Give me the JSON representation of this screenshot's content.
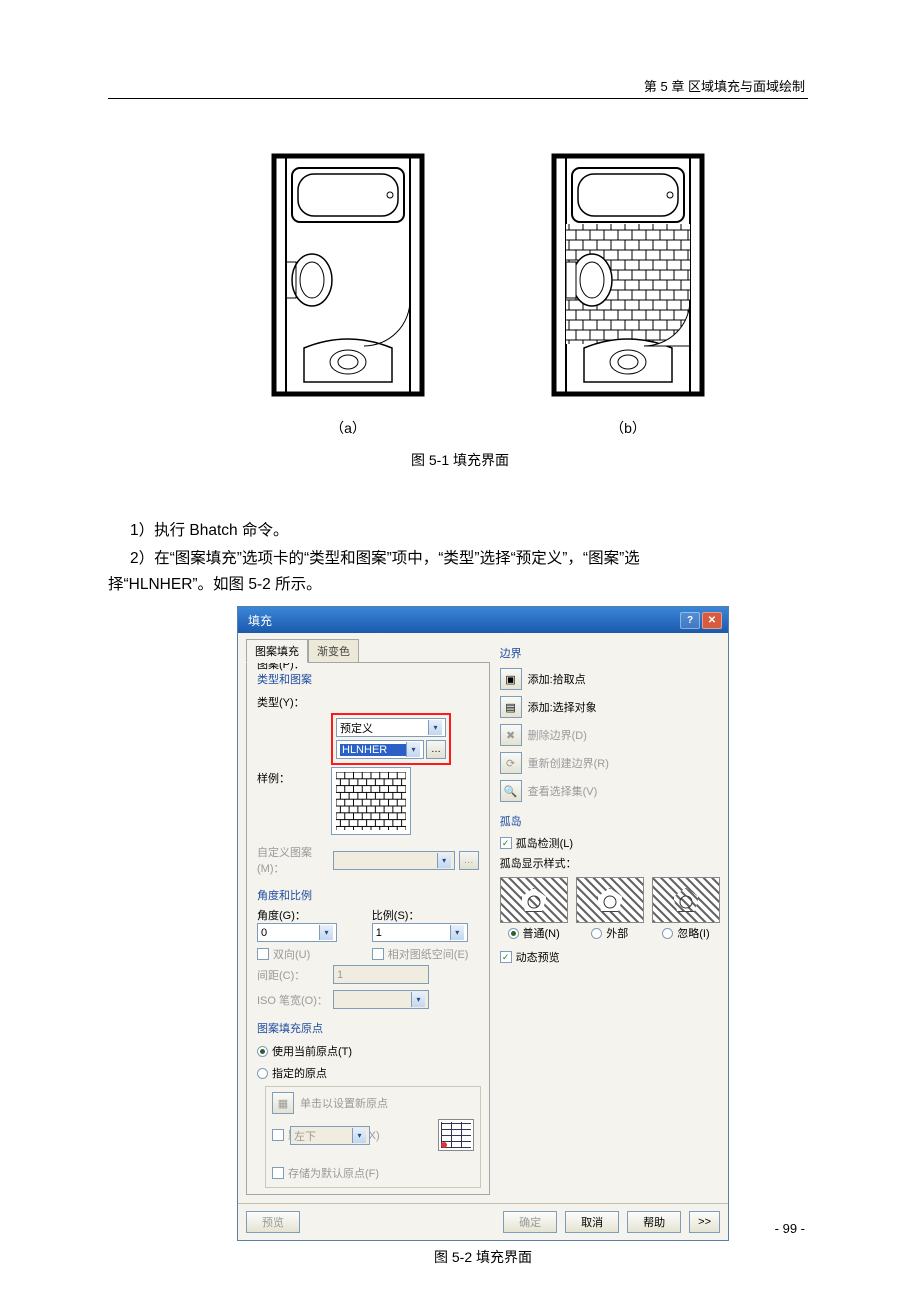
{
  "header": {
    "chapter": "第 5 章  区域填充与面域绘制"
  },
  "fig51": {
    "label_a": "（a）",
    "label_b": "（b）",
    "caption": "图 5-1 填充界面"
  },
  "body": {
    "line1": "1）执行 Bhatch 命令。",
    "line2": "2）在“图案填充”选项卡的“类型和图案”项中，“类型”选择“预定义”，“图案”选",
    "line3": "择“HLNHER”。如图 5-2 所示。"
  },
  "dialog": {
    "title": "填充",
    "tabs": {
      "hatch": "图案填充",
      "gradient": "渐变色"
    },
    "type_group": {
      "legend": "类型和图案",
      "type_label": "类型(Y)：",
      "type_value": "预定义",
      "pattern_label": "图案(P)：",
      "pattern_value": "HLNHER",
      "sample_label": "样例：",
      "custom_label": "自定义图案(M)："
    },
    "angle_group": {
      "legend": "角度和比例",
      "angle_label": "角度(G)：",
      "angle_value": "0",
      "scale_label": "比例(S)：",
      "scale_value": "1",
      "double_label": "双向(U)",
      "relative_label": "相对图纸空间(E)",
      "spacing_label": "间距(C)：",
      "spacing_value": "1",
      "iso_label": "ISO 笔宽(O)："
    },
    "origin_group": {
      "legend": "图案填充原点",
      "use_current": "使用当前原点(T)",
      "specified": "指定的原点",
      "click_set": "单击以设置新原点",
      "default_extent": "默认为边界范围(X)",
      "pos_value": "左下",
      "store_default": "存储为默认原点(F)"
    },
    "boundary": {
      "legend": "边界",
      "pick": "添加:拾取点",
      "select": "添加:选择对象",
      "remove": "删除边界(D)",
      "recreate": "重新创建边界(R)",
      "view_sel": "查看选择集(V)"
    },
    "islands": {
      "legend": "孤岛",
      "detect": "孤岛检测(L)",
      "style_label": "孤岛显示样式：",
      "normal": "普通(N)",
      "outer": "外部",
      "ignore": "忽略(I)"
    },
    "dynamic_preview": "动态预览",
    "buttons": {
      "preview": "预览",
      "ok": "确定",
      "cancel": "取消",
      "help": "帮助",
      "more": ">>"
    }
  },
  "fig52": {
    "caption": "图 5-2 填充界面"
  },
  "page_number": "- 99 -"
}
